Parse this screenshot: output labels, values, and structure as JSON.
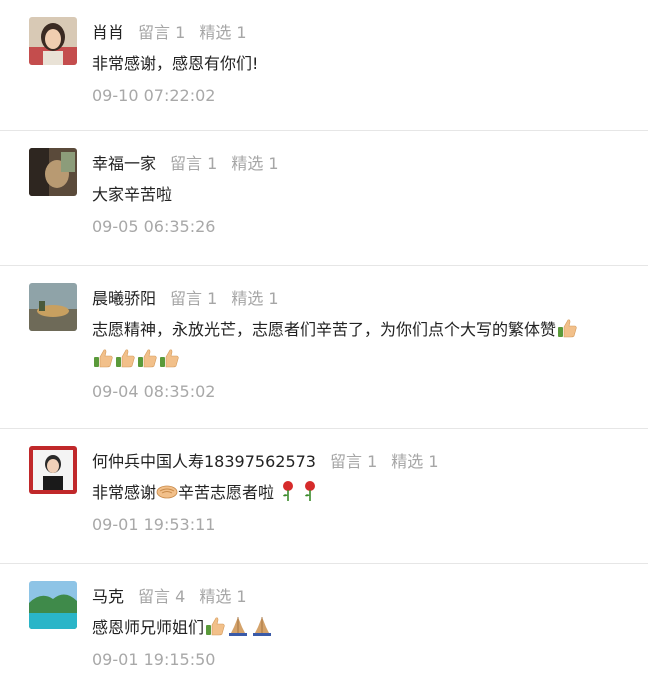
{
  "labels": {
    "liuyan": "留言",
    "jingxuan": "精选"
  },
  "comments": [
    {
      "name": "肖肖",
      "liuyan": "1",
      "jingxuan": "1",
      "text": "非常感谢，感恩有你们!",
      "time": "09-10 07:22:02"
    },
    {
      "name": "幸福一家",
      "liuyan": "1",
      "jingxuan": "1",
      "text": "大家辛苦啦",
      "time": "09-05 06:35:26"
    },
    {
      "name": "晨曦骄阳",
      "liuyan": "1",
      "jingxuan": "1",
      "text": "志愿精神，永放光芒，志愿者们辛苦了，为你们点个大写的繁体赞",
      "time": "09-04 08:35:02",
      "emoji_after": [
        "thumbs-up",
        "thumbs-up",
        "thumbs-up",
        "thumbs-up",
        "thumbs-up"
      ]
    },
    {
      "name": "何仲兵中国人寿18397562573",
      "liuyan": "1",
      "jingxuan": "1",
      "text_a": "非常感谢",
      "text_b": "辛苦志愿者啦",
      "time": "09-01 19:53:11",
      "emoji": [
        "handshake",
        "rose",
        "rose"
      ]
    },
    {
      "name": "马克",
      "liuyan": "4",
      "jingxuan": "1",
      "text": "感恩师兄师姐们",
      "time": "09-01 19:15:50",
      "emoji": [
        "thumbs-up",
        "praying-hands",
        "praying-hands"
      ]
    }
  ]
}
